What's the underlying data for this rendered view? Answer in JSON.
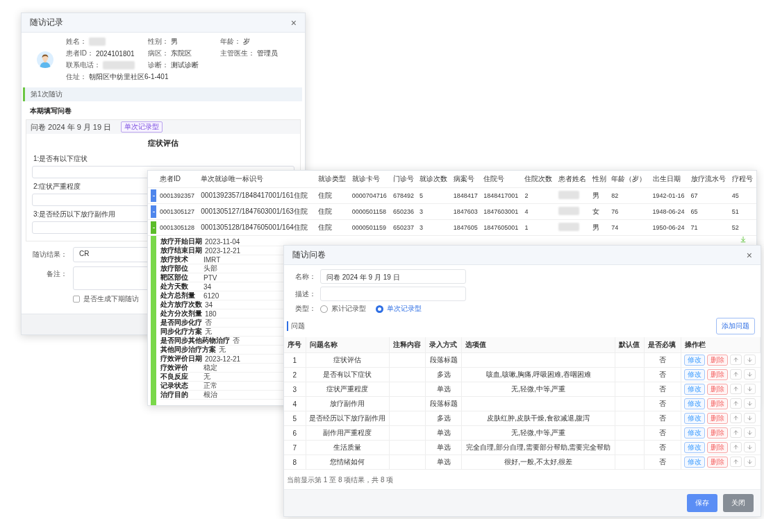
{
  "follow_up_record": {
    "title": "随访记录",
    "close": "×",
    "patient_rows": [
      [
        {
          "label": "姓名：",
          "redacted": true
        },
        {
          "label": "性别：",
          "value": "男"
        },
        {
          "label": "年龄：",
          "value": "岁"
        }
      ],
      [
        {
          "label": "患者ID：",
          "value": "2024101801"
        },
        {
          "label": "病区：",
          "value": "东院区"
        },
        {
          "label": "主管医生：",
          "value": "管理员"
        }
      ],
      [
        {
          "label": "联系电话：",
          "redacted": true
        },
        {
          "label": "诊断：",
          "value": "测试诊断"
        }
      ],
      [
        {
          "label": "住址：",
          "value": "朝阳区中纺里社区6-1-401"
        }
      ]
    ],
    "visit": "第1次随访",
    "section": "本期填写问卷",
    "questionnaire": {
      "title": "问卷 2024 年 9 月 19 日",
      "tag": "单次记录型",
      "heading": "症状评估",
      "questions": [
        {
          "label": "1:是否有以下症状"
        },
        {
          "label": "2:症状严重程度"
        },
        {
          "label": "3:是否经历以下放疗副作用"
        }
      ]
    },
    "fields": [
      {
        "label": "随访结果：",
        "value": "CR",
        "kind": "input"
      },
      {
        "label": "备注：",
        "kind": "textarea"
      }
    ],
    "next_visit": {
      "label": "是否生成下期随访",
      "checked": false
    }
  },
  "records": {
    "columns": [
      "患者ID",
      "单次就诊唯一标识号",
      "就诊类型",
      "就诊卡号",
      "门诊号",
      "就诊次数",
      "病案号",
      "住院号",
      "住院次数",
      "患者姓名",
      "性别",
      "年龄（岁）",
      "出生日期",
      "放疗流水号",
      "疗程号"
    ],
    "rows": [
      {
        "expanded": false,
        "cells": [
          {
            "text": "0001392357"
          },
          {
            "text": "0001392357/1848417001/161住院"
          },
          {
            "text": "住院"
          },
          {
            "text": "0000704716"
          },
          {
            "text": "678492"
          },
          {
            "text": "5"
          },
          {
            "text": "1848417"
          },
          {
            "text": "1848417001"
          },
          {
            "text": "2"
          },
          {
            "redacted": true
          },
          {
            "text": "男"
          },
          {
            "text": "82"
          },
          {
            "text": "1942-01-16"
          },
          {
            "text": "67"
          },
          {
            "text": "45"
          }
        ]
      },
      {
        "expanded": false,
        "cells": [
          {
            "text": "0001305127"
          },
          {
            "text": "0001305127/1847603001/163住院"
          },
          {
            "text": "住院"
          },
          {
            "text": "0000501158"
          },
          {
            "text": "650236"
          },
          {
            "text": "3"
          },
          {
            "text": "1847603"
          },
          {
            "text": "1847603001"
          },
          {
            "text": "4"
          },
          {
            "redacted": true
          },
          {
            "text": "女"
          },
          {
            "text": "76"
          },
          {
            "text": "1948-06-24"
          },
          {
            "text": "65"
          },
          {
            "text": "51"
          }
        ]
      },
      {
        "expanded": true,
        "cells": [
          {
            "text": "0001305128"
          },
          {
            "text": "0001305128/1847605001/164住院"
          },
          {
            "text": "住院"
          },
          {
            "text": "0000501159"
          },
          {
            "text": "650237"
          },
          {
            "text": "3"
          },
          {
            "text": "1847605"
          },
          {
            "text": "1847605001"
          },
          {
            "text": "1"
          },
          {
            "redacted": true
          },
          {
            "text": "男"
          },
          {
            "text": "74"
          },
          {
            "text": "1950-06-24"
          },
          {
            "text": "71"
          },
          {
            "text": "52"
          }
        ]
      }
    ],
    "details": [
      {
        "label": "放疗开始日期",
        "value": "2023-11-04"
      },
      {
        "label": "放疗结束日期",
        "value": "2023-12-21"
      },
      {
        "label": "放疗技术",
        "value": "IMRT"
      },
      {
        "label": "放疗部位",
        "value": "头部"
      },
      {
        "label": "靶区部位",
        "value": "PTV"
      },
      {
        "label": "处方天数",
        "value": "34"
      },
      {
        "label": "处方总剂量",
        "value": "6120"
      },
      {
        "label": "处方放疗次数",
        "value": "34"
      },
      {
        "label": "处方分次剂量",
        "value": "180"
      },
      {
        "label": "是否同步化疗",
        "value": "否"
      },
      {
        "label": "同步化疗方案",
        "value": "无"
      },
      {
        "label": "是否同步其他药物治疗",
        "value": "否"
      },
      {
        "label": "其他同步治疗方案",
        "value": "无"
      },
      {
        "label": "疗效评价日期",
        "value": "2023-12-21"
      },
      {
        "label": "疗效评价",
        "value": "稳定"
      },
      {
        "label": "不良反应",
        "value": "无"
      },
      {
        "label": "记录状态",
        "value": "正常"
      },
      {
        "label": "治疗目的",
        "value": "根治"
      }
    ]
  },
  "questionnaire_editor": {
    "title": "随访问卷",
    "close": "×",
    "name": {
      "label": "名称：",
      "value": "问卷 2024 年 9 月 19 日"
    },
    "description": {
      "label": "描述："
    },
    "type": {
      "label": "类型：",
      "options": [
        {
          "label": "累计记录型",
          "selected": false
        },
        {
          "label": "单次记录型",
          "selected": true
        }
      ]
    },
    "section": "问题",
    "add_button": "添加问题",
    "columns": [
      "序号",
      "问题名称",
      "注释内容",
      "录入方式",
      "选项值",
      "默认值",
      "是否必填",
      "操作栏"
    ],
    "rows": [
      {
        "no": "1",
        "name": "症状评估",
        "mode": "段落标题",
        "required": "否",
        "actions": [
          "修改",
          "删除"
        ]
      },
      {
        "no": "2",
        "name": "是否有以下症状",
        "mode": "多选",
        "options": "咳血,咳嗽,胸痛,呼吸困难,吞咽困难",
        "required": "否",
        "actions": [
          "修改",
          "删除"
        ]
      },
      {
        "no": "3",
        "name": "症状严重程度",
        "mode": "单选",
        "options": "无,轻微,中等,严重",
        "required": "否",
        "actions": [
          "修改",
          "删除"
        ]
      },
      {
        "no": "4",
        "name": "放疗副作用",
        "mode": "段落标题",
        "required": "否",
        "actions": [
          "修改",
          "删除"
        ]
      },
      {
        "no": "5",
        "name": "是否经历以下放疗副作用",
        "mode": "多选",
        "options": "皮肤红肿,皮肤干燥,食欲减退,腹泻",
        "required": "否",
        "actions": [
          "修改",
          "删除"
        ]
      },
      {
        "no": "6",
        "name": "副作用严重程度",
        "mode": "单选",
        "options": "无,轻微,中等,严重",
        "required": "否",
        "actions": [
          "修改",
          "删除"
        ]
      },
      {
        "no": "7",
        "name": "生活质量",
        "mode": "单选",
        "options": "完全自理,部分自理,需要部分帮助,需要完全帮助",
        "required": "否",
        "actions": [
          "修改",
          "删除"
        ]
      },
      {
        "no": "8",
        "name": "您情绪如何",
        "mode": "单选",
        "options": "很好,一般,不太好,很差",
        "required": "否",
        "actions": [
          "修改",
          "删除"
        ]
      }
    ],
    "summary": "当前显示第 1 至 8 项结果，共 8 项",
    "buttons": [
      {
        "label": "保存",
        "kind": "primary"
      },
      {
        "label": "关闭",
        "kind": "secondary"
      }
    ]
  }
}
